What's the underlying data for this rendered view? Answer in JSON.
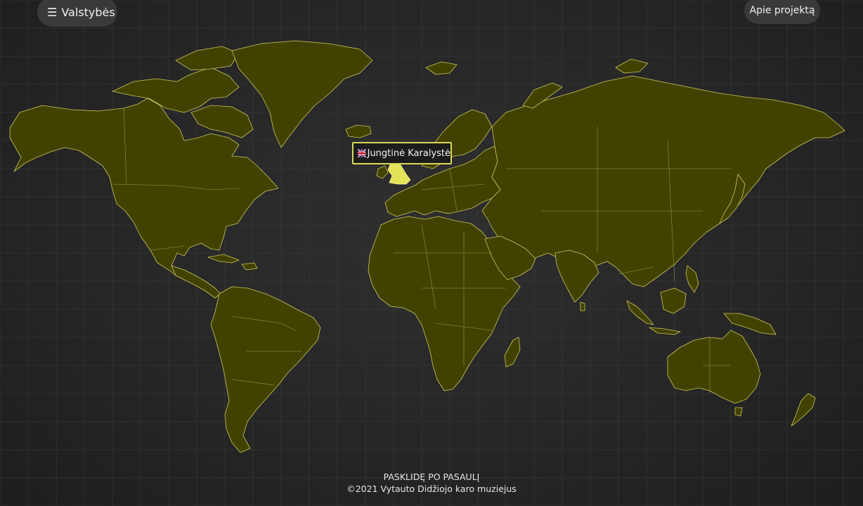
{
  "header": {
    "menu_icon": "hamburger-icon",
    "countries_label": "Valstybės",
    "about_label": "Apie projektą"
  },
  "map": {
    "land_color": "#424200",
    "border_color": "#c8c85a",
    "highlight_color": "#e3e35a",
    "highlighted_country": "Jungtinė Karalystė"
  },
  "tooltip": {
    "flag_icon": "uk-flag-icon",
    "text": "Jungtinė Karalystė"
  },
  "footer": {
    "title": "PASKLIDĘ PO PASAULĮ",
    "copyright": "©2021 Vytauto Didžiojo karo muziejus"
  }
}
